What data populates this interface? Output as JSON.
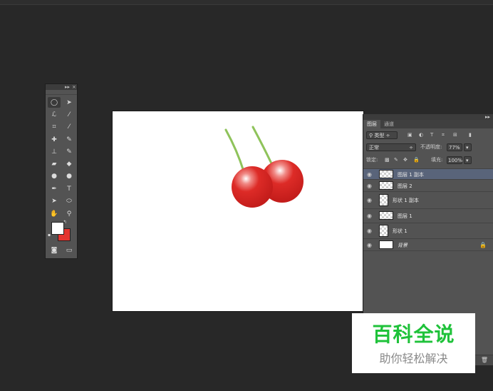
{
  "toolbox": {
    "collapse_label": "▸▸",
    "close_label": "×",
    "tools": [
      {
        "icon": "ellipse-marquee-icon",
        "glyph": "◯"
      },
      {
        "icon": "move-tool-icon",
        "glyph": "➤"
      },
      {
        "icon": "lasso-icon",
        "glyph": "ℒ"
      },
      {
        "icon": "magic-wand-icon",
        "glyph": "⁄"
      },
      {
        "icon": "crop-icon",
        "glyph": "⌗"
      },
      {
        "icon": "eyedropper-icon",
        "glyph": "⁄"
      },
      {
        "icon": "healing-brush-icon",
        "glyph": "✚"
      },
      {
        "icon": "brush-icon",
        "glyph": "✎"
      },
      {
        "icon": "stamp-icon",
        "glyph": "⊥"
      },
      {
        "icon": "history-brush-icon",
        "glyph": "✎"
      },
      {
        "icon": "eraser-icon",
        "glyph": "▰"
      },
      {
        "icon": "paint-bucket-icon",
        "glyph": "◆"
      },
      {
        "icon": "blur-icon",
        "glyph": "●"
      },
      {
        "icon": "dodge-icon",
        "glyph": "●"
      },
      {
        "icon": "pen-icon",
        "glyph": "✒"
      },
      {
        "icon": "type-icon",
        "glyph": "T"
      },
      {
        "icon": "path-selection-icon",
        "glyph": "➤"
      },
      {
        "icon": "shape-icon",
        "glyph": "⬭"
      },
      {
        "icon": "hand-icon",
        "glyph": "✋"
      },
      {
        "icon": "zoom-icon",
        "glyph": "🔍"
      },
      {
        "icon": "quick-mask-icon",
        "glyph": "◙"
      },
      {
        "icon": "screen-mode-icon",
        "glyph": "▭"
      }
    ],
    "foreground_color": "#ffffff",
    "background_color": "#e4342e"
  },
  "layers_panel": {
    "tabs": [
      "图层",
      "通道"
    ],
    "filter_label": "类型",
    "blend_mode": "正常",
    "opacity_label": "不透明度:",
    "opacity_value": "77%",
    "lock_label": "锁定:",
    "fill_label": "填充:",
    "fill_value": "100%",
    "layers": [
      {
        "name": "图层 1 副本",
        "selected": true
      },
      {
        "name": "图层 2",
        "selected": false
      },
      {
        "name": "形状 1 副本",
        "selected": false
      },
      {
        "name": "图层 1",
        "selected": false
      },
      {
        "name": "形状 1",
        "selected": false
      },
      {
        "name": "背景",
        "selected": false
      }
    ]
  },
  "watermark": {
    "title": "百科全说",
    "subtitle": "助你轻松解决"
  }
}
